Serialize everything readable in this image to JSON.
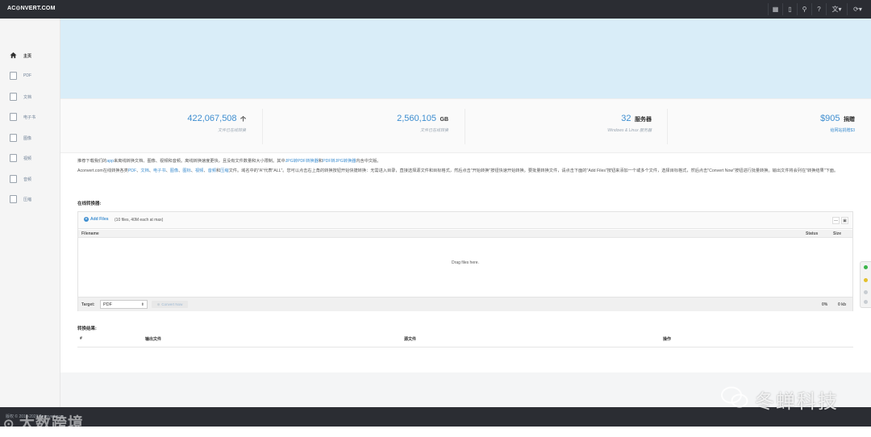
{
  "header": {
    "brand": "AC⊙NVERT.COM",
    "tools": [
      "grid-icon",
      "tablet-icon",
      "search-icon",
      "help-icon",
      "language-icon",
      "refresh-icon"
    ]
  },
  "sidebar": {
    "items": [
      {
        "label": "主页",
        "icon": "home-icon",
        "active": true
      },
      {
        "label": "PDF",
        "icon": "file-icon"
      },
      {
        "label": "文档",
        "icon": "document-icon"
      },
      {
        "label": "电子书",
        "icon": "ebook-icon"
      },
      {
        "label": "图像",
        "icon": "image-icon"
      },
      {
        "label": "视频",
        "icon": "video-icon"
      },
      {
        "label": "音频",
        "icon": "audio-icon"
      },
      {
        "label": "压缩",
        "icon": "archive-icon"
      }
    ]
  },
  "stats": [
    {
      "value": "422,067,508",
      "unit": "个",
      "sub": "文件已在线转换"
    },
    {
      "value": "2,560,105",
      "unit": "GB",
      "sub": "文件已在线转换"
    },
    {
      "value": "32",
      "unit": "服务器",
      "sub": "Windows & Linux 服务器"
    },
    {
      "value": "$905",
      "unit": "捐赠",
      "sub": "给网站捐赠$3"
    }
  ],
  "intro": {
    "line1_prefix": "推荐下载我们的",
    "line1_app": "app",
    "line1_mid": "来离线转换文档、图像、视频和音频。离线转换速度更快，且没有文件数量和大小限制。其中",
    "link_jpg_pdf": "JPG转PDF转换器",
    "line1_and": "和",
    "link_pdf_jpg": "PDF转JPG转换器",
    "line1_suffix": "内含中文版。",
    "line2_prefix": "Aconvert.com在线转换各类",
    "link_pdf": "PDF",
    "link_doc": "文档",
    "link_ebook": "电子书",
    "link_image": "图像",
    "link_icon": "图标",
    "link_video": "视频",
    "link_audio": "音频",
    "link_archive": "压缩",
    "sep": "、",
    "and": "和",
    "line2_rest": "文件。域名中的\"A\"代表\"ALL\"。您可以点击右上角的转换按钮开始快捷转换：无需进入目录，直接选择源文件和目标格式，然后点击\"开始转换\"按钮快速开始转换。要批量转换文件，请点击下面的\"Add Files\"按钮来添加一个或多个文件，选择目标格式，然后点击\"Convert Now\"按钮进行批量转换。输出文件将会列在\"转换结果\"下面。"
  },
  "converter": {
    "title": "在线转换器:",
    "add_files": "Add Files",
    "limit": "(10 files, 40M each at max)",
    "col_filename": "Filename",
    "col_status": "Status",
    "col_size": "Size",
    "drop_text": "Drag files here.",
    "target_label": "Target:",
    "target_value": "PDF",
    "convert_button": "Convert Now",
    "progress": "0%",
    "total_size": "0 kb"
  },
  "results": {
    "title": "转换结果:",
    "col_index": "#",
    "col_output": "输出文件",
    "col_source": "源文件",
    "col_action": "操作"
  },
  "footer": {
    "copyright": "版权 © 2010-2023 Aconvert.com"
  },
  "watermarks": {
    "left": "大数跨境",
    "right": "冬蝉科技"
  },
  "colors": {
    "topbar": "#2b2d33",
    "hero": "#d9edf8",
    "link": "#3e8ed0"
  }
}
